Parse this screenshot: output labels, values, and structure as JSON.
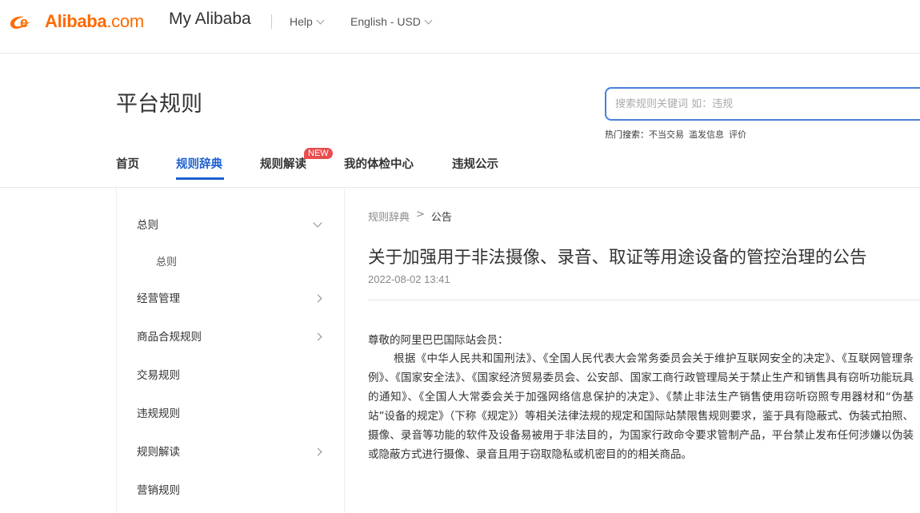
{
  "topbar": {
    "logo_text": "Alibaba",
    "logo_suffix": ".com",
    "my_alibaba": "My Alibaba",
    "help": "Help",
    "language": "English - USD"
  },
  "header": {
    "title": "平台规则",
    "search_placeholder": "搜索规则关键词 如：违规",
    "hot_label": "热门搜索：",
    "hot_terms": [
      "不当交易",
      "滥发信息",
      "评价"
    ]
  },
  "nav": {
    "items": [
      "首页",
      "规则辞典",
      "规则解读",
      "我的体检中心",
      "违规公示"
    ],
    "badge": "NEW"
  },
  "sidebar": {
    "items": [
      "总则",
      "总则",
      "经营管理",
      "商品合规规则",
      "交易规则",
      "违规规则",
      "规则解读",
      "营销规则"
    ]
  },
  "breadcrumb": {
    "parent": "规则辞典",
    "separator": ">",
    "current": "公告"
  },
  "article": {
    "title": "关于加强用于非法摄像、录音、取证等用途设备的管控治理的公告",
    "date": "2022-08-02 13:41",
    "greeting": "尊敬的阿里巴巴国际站会员：",
    "body": "根据《中华人民共和国刑法》、《全国人民代表大会常务委员会关于维护互联网安全的决定》、《互联网管理条例》、《国家安全法》、《国家经济贸易委员会、公安部、国家工商行政管理局关于禁止生产和销售具有窃听功能玩具的通知》、《全国人大常委会关于加强网络信息保护的决定》、《禁止非法生产销售使用窃听窃照专用器材和“伪基站”设备的规定》（下称《规定》）等相关法律法规的规定和国际站禁限售规则要求，鉴于具有隐蔽式、伪装式拍照、摄像、录音等功能的软件及设备易被用于非法目的，为国家行政命令要求管制产品，平台禁止发布任何涉嫌以伪装或隐蔽方式进行摄像、录音且用于窃取隐私或机密目的的相关商品。"
  },
  "colors": {
    "brand": "#ff6a00",
    "accent": "#1c5fd1",
    "badge": "#e74e4e"
  }
}
